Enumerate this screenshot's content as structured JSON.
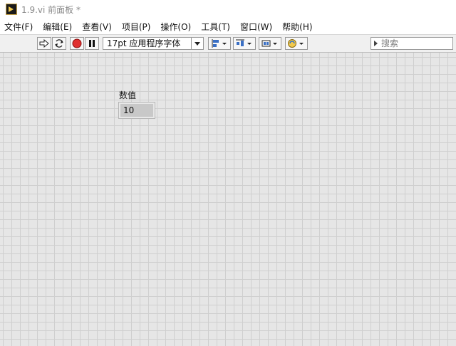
{
  "window": {
    "title": "1.9.vi 前面板 *",
    "icon": "labview-vi-icon"
  },
  "menu": [
    "文件(F)",
    "编辑(E)",
    "查看(V)",
    "项目(P)",
    "操作(O)",
    "工具(T)",
    "窗口(W)",
    "帮助(H)"
  ],
  "toolbar": {
    "buttons": [
      {
        "name": "run-button",
        "icon": "run-arrow-icon"
      },
      {
        "name": "run-continuously-button",
        "icon": "run-continuously-icon"
      },
      {
        "name": "abort-button",
        "icon": "abort-stop-icon"
      },
      {
        "name": "pause-button",
        "icon": "pause-icon"
      }
    ],
    "font_select": "17pt 应用程序字体",
    "tools": [
      {
        "name": "align-objects-button",
        "icon": "align-icon"
      },
      {
        "name": "distribute-objects-button",
        "icon": "distribute-icon"
      },
      {
        "name": "resize-objects-button",
        "icon": "resize-icon"
      },
      {
        "name": "reorder-button",
        "icon": "reorder-icon"
      }
    ],
    "search_placeholder": "搜索"
  },
  "front_panel": {
    "numeric_label": "数值",
    "numeric_value": "10"
  },
  "colors": {
    "canvas": "#e6e6e6",
    "grid": "#cfcfcf",
    "abort_red": "#e03030"
  }
}
